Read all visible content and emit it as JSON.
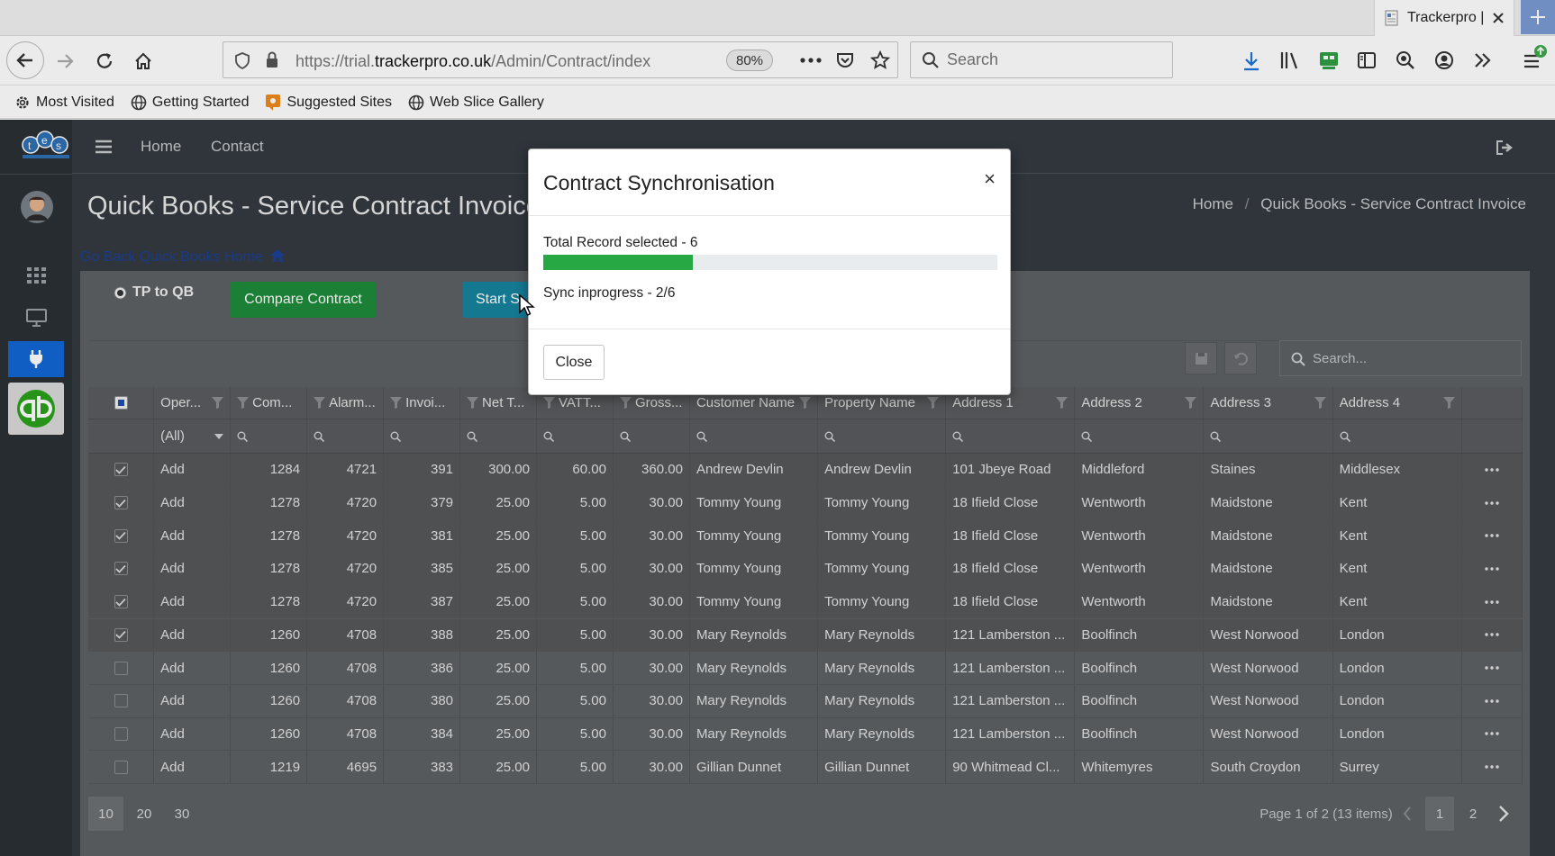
{
  "browser": {
    "tab_title": "Trackerpro |",
    "url_prefix": "https://trial.",
    "url_domain": "trackerpro.co.uk",
    "url_path": "/Admin/Contract/index",
    "zoom": "80%",
    "search_placeholder": "Search",
    "bookmarks": [
      "Most Visited",
      "Getting Started",
      "Suggested Sites",
      "Web Slice Gallery"
    ]
  },
  "topnav": {
    "home": "Home",
    "contact": "Contact"
  },
  "page": {
    "title": "Quick Books - Service Contract Invoice",
    "breadcrumb_home": "Home",
    "breadcrumb_sep": "/",
    "breadcrumb_current": "Quick Books - Service Contract Invoice",
    "go_back": "Go Back Quick Books Home",
    "radio_label": "TP to QB",
    "compare_button": "Compare Contract",
    "start_button": "Start S",
    "grid_search_placeholder": "Search..."
  },
  "grid": {
    "columns": [
      "Oper...",
      "Com...",
      "Alarm...",
      "Invoi...",
      "Net T...",
      "VATT...",
      "Gross...",
      "Customer Name",
      "Property Name",
      "Address 1",
      "Address 2",
      "Address 3",
      "Address 4"
    ],
    "operation_filter": "(All)",
    "rows": [
      {
        "checked": true,
        "op": "Add",
        "com": "1284",
        "alarm": "4721",
        "inv": "391",
        "net": "300.00",
        "vat": "60.00",
        "gross": "360.00",
        "cust": "Andrew Devlin",
        "prop": "Andrew Devlin",
        "a1": "101 Jbeye Road",
        "a2": "Middleford",
        "a3": "Staines",
        "a4": "Middlesex"
      },
      {
        "checked": true,
        "op": "Add",
        "com": "1278",
        "alarm": "4720",
        "inv": "379",
        "net": "25.00",
        "vat": "5.00",
        "gross": "30.00",
        "cust": "Tommy Young",
        "prop": "Tommy Young",
        "a1": "18 Ifield Close",
        "a2": "Wentworth",
        "a3": "Maidstone",
        "a4": "Kent"
      },
      {
        "checked": true,
        "op": "Add",
        "com": "1278",
        "alarm": "4720",
        "inv": "381",
        "net": "25.00",
        "vat": "5.00",
        "gross": "30.00",
        "cust": "Tommy Young",
        "prop": "Tommy Young",
        "a1": "18 Ifield Close",
        "a2": "Wentworth",
        "a3": "Maidstone",
        "a4": "Kent"
      },
      {
        "checked": true,
        "op": "Add",
        "com": "1278",
        "alarm": "4720",
        "inv": "385",
        "net": "25.00",
        "vat": "5.00",
        "gross": "30.00",
        "cust": "Tommy Young",
        "prop": "Tommy Young",
        "a1": "18 Ifield Close",
        "a2": "Wentworth",
        "a3": "Maidstone",
        "a4": "Kent"
      },
      {
        "checked": true,
        "op": "Add",
        "com": "1278",
        "alarm": "4720",
        "inv": "387",
        "net": "25.00",
        "vat": "5.00",
        "gross": "30.00",
        "cust": "Tommy Young",
        "prop": "Tommy Young",
        "a1": "18 Ifield Close",
        "a2": "Wentworth",
        "a3": "Maidstone",
        "a4": "Kent"
      },
      {
        "checked": true,
        "op": "Add",
        "com": "1260",
        "alarm": "4708",
        "inv": "388",
        "net": "25.00",
        "vat": "5.00",
        "gross": "30.00",
        "cust": "Mary Reynolds",
        "prop": "Mary Reynolds",
        "a1": "121 Lamberston ...",
        "a2": "Boolfinch",
        "a3": "West Norwood",
        "a4": "London"
      },
      {
        "checked": false,
        "op": "Add",
        "com": "1260",
        "alarm": "4708",
        "inv": "386",
        "net": "25.00",
        "vat": "5.00",
        "gross": "30.00",
        "cust": "Mary Reynolds",
        "prop": "Mary Reynolds",
        "a1": "121 Lamberston ...",
        "a2": "Boolfinch",
        "a3": "West Norwood",
        "a4": "London"
      },
      {
        "checked": false,
        "op": "Add",
        "com": "1260",
        "alarm": "4708",
        "inv": "380",
        "net": "25.00",
        "vat": "5.00",
        "gross": "30.00",
        "cust": "Mary Reynolds",
        "prop": "Mary Reynolds",
        "a1": "121 Lamberston ...",
        "a2": "Boolfinch",
        "a3": "West Norwood",
        "a4": "London"
      },
      {
        "checked": false,
        "op": "Add",
        "com": "1260",
        "alarm": "4708",
        "inv": "384",
        "net": "25.00",
        "vat": "5.00",
        "gross": "30.00",
        "cust": "Mary Reynolds",
        "prop": "Mary Reynolds",
        "a1": "121 Lamberston ...",
        "a2": "Boolfinch",
        "a3": "West Norwood",
        "a4": "London"
      },
      {
        "checked": false,
        "op": "Add",
        "com": "1219",
        "alarm": "4695",
        "inv": "383",
        "net": "25.00",
        "vat": "5.00",
        "gross": "30.00",
        "cust": "Gillian Dunnet",
        "prop": "Gillian Dunnet",
        "a1": "90 Whitmead Cl...",
        "a2": "Whitemyres",
        "a3": "South Croydon",
        "a4": "Surrey"
      }
    ]
  },
  "pager": {
    "sizes": [
      "10",
      "20",
      "30"
    ],
    "info": "Page 1 of 2 (13 items)",
    "pages": [
      "1",
      "2"
    ]
  },
  "modal": {
    "title": "Contract Synchronisation",
    "close_x": "×",
    "total_label": "Total Record selected - 6",
    "progress": 0.33,
    "status": "Sync inprogress - 2/6",
    "close_button": "Close"
  },
  "colors": {
    "progress": "#28a745",
    "compare": "#1e8a3a",
    "start": "#17839e",
    "active_nav": "#1266d4"
  }
}
